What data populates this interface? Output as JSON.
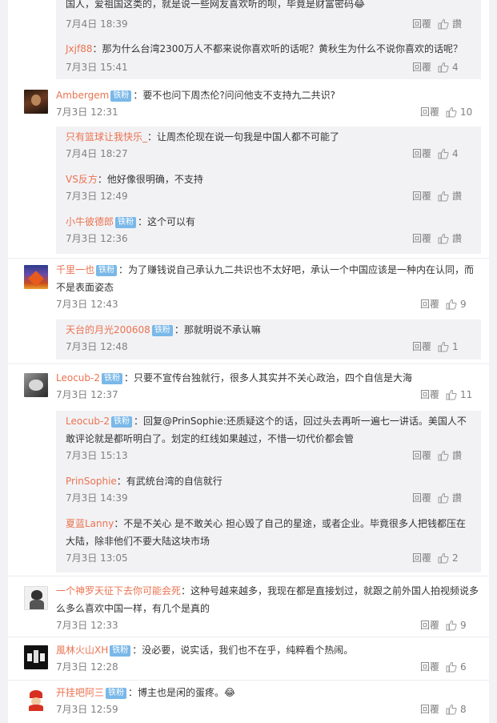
{
  "top_subs": [
    {
      "text": "国人，爱祖国这类的，就是说一些网友喜欢听的呗，毕竟是财富密码😂",
      "time": "7月4日 18:39",
      "reply": "回覆",
      "likes": "讚"
    },
    {
      "user": "Jxjf88",
      "text": "：那为什么台湾2300万人不都来说你喜欢听的话呢？黄秋生为什么不说你喜欢的话呢？",
      "time": "7月3日 15:41",
      "reply": "回覆",
      "likes": "4"
    }
  ],
  "comments": [
    {
      "user": "Ambergem",
      "vip": "铁粉",
      "text": "：要不也问下周杰伦?问问他支不支持九二共识?",
      "time": "7月3日 12:31",
      "reply": "回覆",
      "likes": "10",
      "subs": [
        {
          "user": "只有篮球让我快乐_",
          "text": "：让周杰伦现在说一句我是中国人都不可能了",
          "time": "7月4日 18:27",
          "reply": "回覆",
          "likes": "4"
        },
        {
          "user": "VS反方",
          "text": "：他好像很明确，不支持",
          "time": "7月3日 12:49",
          "reply": "回覆",
          "likes": "讚"
        },
        {
          "user": "小牛彼德郎",
          "vip": "铁粉",
          "text": "：这个可以有",
          "time": "7月3日 12:36",
          "reply": "回覆",
          "likes": "讚"
        }
      ]
    },
    {
      "user": "千里一也",
      "vip": "铁粉",
      "text": "：为了赚钱说自己承认九二共识也不太好吧，承认一个中国应该是一种内在认同，而不是表面姿态",
      "time": "7月3日 12:43",
      "reply": "回覆",
      "likes": "9",
      "subs": [
        {
          "user": "天台的月光200608",
          "vip": "铁粉",
          "text": "：那就明说不承认嘛",
          "time": "7月3日 12:48",
          "reply": "回覆",
          "likes": "1"
        }
      ]
    },
    {
      "user": "Leocub-2",
      "vip": "铁粉",
      "text": "：只要不宣传台独就行，很多人其实并不关心政治，四个自信是大海",
      "time": "7月3日 12:37",
      "reply": "回覆",
      "likes": "11",
      "subs": [
        {
          "user": "Leocub-2",
          "vip": "铁粉",
          "text": "：回复@PrinSophie:还质疑这个的话，回过头去再听一遍七一讲话。美国人不敢评论就是都听明白了。划定的红线如果越过，不惜一切代价都会管",
          "time": "7月3日 15:13",
          "reply": "回覆",
          "likes": "讚"
        },
        {
          "user": "PrinSophie",
          "text": "：有武统台湾的自信就行",
          "time": "7月3日 14:39",
          "reply": "回覆",
          "likes": "讚"
        },
        {
          "user": "夏蓝Lanny",
          "text": "：不是不关心 是不敢关心 担心毁了自己的星途，或者企业。毕竟很多人把钱都压在大陆，除非他们不要大陆这块市场",
          "time": "7月3日 13:05",
          "reply": "回覆",
          "likes": "2"
        }
      ]
    },
    {
      "user": "一个神罗天征下去你可能会死",
      "text": "：这种号越来越多，我现在都是直接划过，就跟之前外国人拍视频说多么多么喜欢中国一样，有几个是真的",
      "time": "7月3日 12:33",
      "reply": "回覆",
      "likes": "9",
      "subs": []
    },
    {
      "user": "風林火山XH",
      "vip": "铁粉",
      "text": "：没必要，说实话，我们也不在乎，纯粹看个热闹。",
      "time": "7月3日 12:28",
      "reply": "回覆",
      "likes": "6",
      "subs": []
    },
    {
      "user": "开挂吧阿三",
      "vip": "铁粉",
      "text": "：博主也是闲的蛋疼。😂",
      "time": "7月3日 12:59",
      "reply": "回覆",
      "likes": "8",
      "subs": []
    }
  ]
}
